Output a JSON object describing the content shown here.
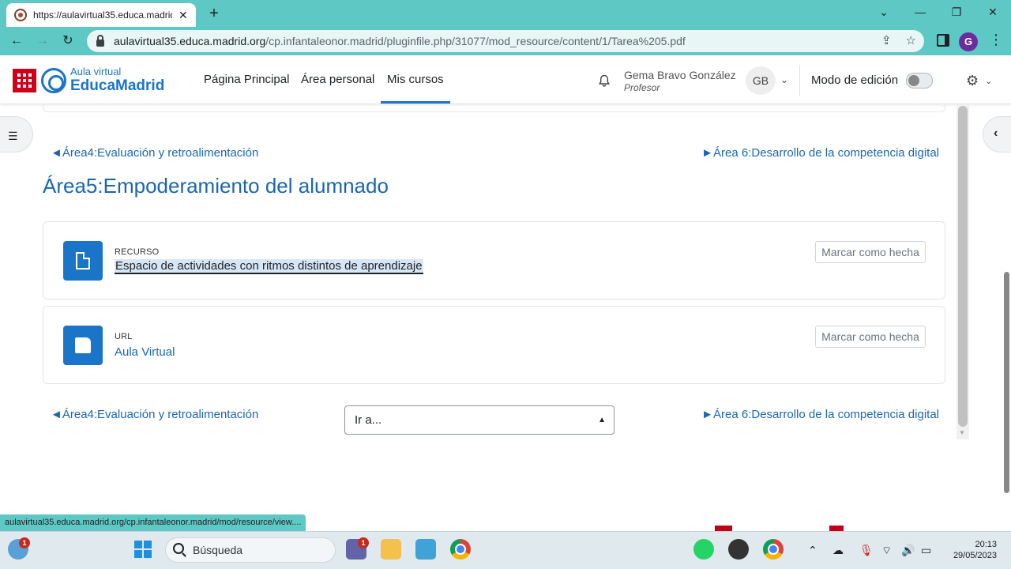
{
  "browser": {
    "tab_title": "https://aulavirtual35.educa.madrid",
    "url_host": "aulavirtual35.educa.madrid.org",
    "url_path": "/cp.infantaleonor.madrid/pluginfile.php/31077/mod_resource/content/1/Tarea%205.pdf",
    "profile_initial": "G",
    "status_url": "aulavirtual35.educa.madrid.org/cp.infantaleonor.madrid/mod/resource/view...."
  },
  "header": {
    "brand_line1": "Aula virtual",
    "brand_line2": "EducaMadrid",
    "nav": [
      "Página Principal",
      "Área personal",
      "Mis cursos"
    ],
    "active_nav": "Mis cursos",
    "user_name": "Gema Bravo González",
    "user_role": "Profesor",
    "avatar_initials": "GB",
    "edit_mode_label": "Modo de edición",
    "edit_mode_on": false
  },
  "section": {
    "prev_link": "◄Área4:Evaluación y retroalimentación",
    "next_link": "►Área 6:Desarrollo de la competencia digital",
    "title": "Área5:Empoderamiento del alumnado",
    "activities": [
      {
        "type": "RECURSO",
        "name": "Espacio de actividades con ritmos distintos de aprendizaje",
        "icon": "document-icon",
        "button": "Marcar como hecha"
      },
      {
        "type": "URL",
        "name": "Aula Virtual",
        "icon": "url-icon",
        "button": "Marcar como hecha"
      }
    ],
    "jump_select": "Ir a..."
  },
  "taskbar": {
    "search_placeholder": "Búsqueda",
    "time": "20:13",
    "date": "29/05/2023",
    "weather_badge": "1",
    "teams_badge": "1"
  },
  "colors": {
    "browser_chrome": "#5ec8c5",
    "link_blue": "#1a66b3",
    "brand_blue": "#1a75c8",
    "madrid_red": "#d0021b"
  }
}
